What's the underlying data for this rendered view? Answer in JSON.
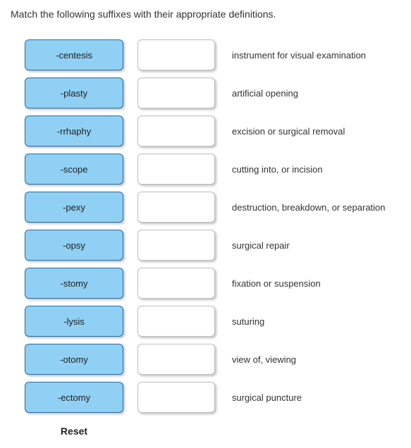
{
  "instruction": "Match the following suffixes with their appropriate definitions.",
  "rows": [
    {
      "suffix": "-centesis",
      "definition": "instrument for visual examination"
    },
    {
      "suffix": "-plasty",
      "definition": "artificial opening"
    },
    {
      "suffix": "-rrhaphy",
      "definition": "excision or surgical removal"
    },
    {
      "suffix": "-scope",
      "definition": "cutting into, or incision"
    },
    {
      "suffix": "-pexy",
      "definition": "destruction, breakdown, or separation"
    },
    {
      "suffix": "-opsy",
      "definition": "surgical repair"
    },
    {
      "suffix": "-stomy",
      "definition": "fixation or suspension"
    },
    {
      "suffix": "-lysis",
      "definition": "suturing"
    },
    {
      "suffix": "-otomy",
      "definition": "view of, viewing"
    },
    {
      "suffix": "-ectomy",
      "definition": "surgical puncture"
    }
  ],
  "reset_label": "Reset"
}
